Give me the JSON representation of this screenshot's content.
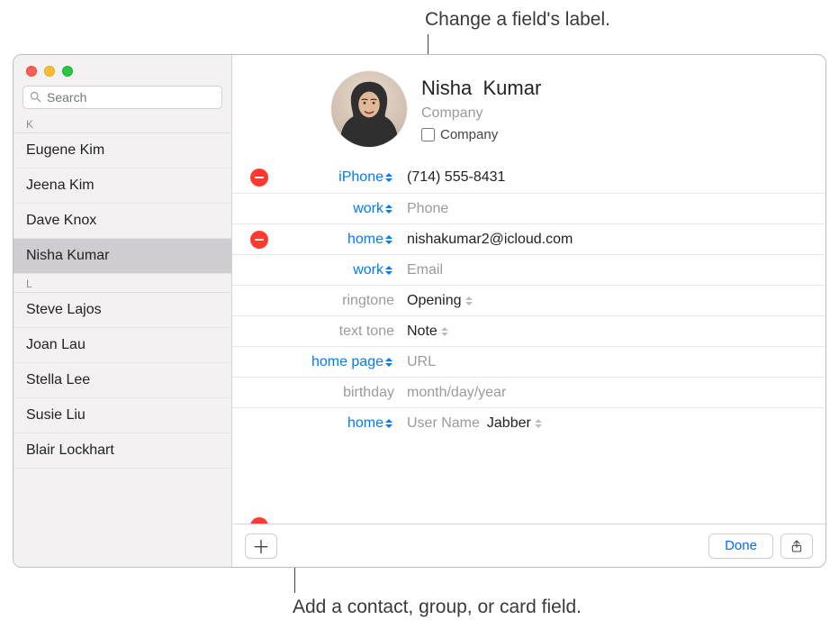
{
  "callouts": {
    "top": "Change a field's label.",
    "bottom": "Add a contact, group, or card field."
  },
  "sidebar": {
    "search_placeholder": "Search",
    "sections": [
      {
        "letter": "K",
        "items": [
          "Eugene Kim",
          "Jeena Kim",
          "Dave Knox",
          "Nisha Kumar"
        ],
        "selected": "Nisha Kumar"
      },
      {
        "letter": "L",
        "items": [
          "Steve Lajos",
          "Joan Lau",
          "Stella Lee",
          "Susie Liu",
          "Blair Lockhart"
        ]
      }
    ]
  },
  "contact": {
    "first_name": "Nisha",
    "last_name": "Kumar",
    "company_placeholder": "Company",
    "company_checkbox_label": "Company",
    "fields": {
      "phone_iphone": {
        "label": "iPhone",
        "value": "(714) 555-8431"
      },
      "phone_work": {
        "label": "work",
        "placeholder": "Phone"
      },
      "email_home": {
        "label": "home",
        "value": "nishakumar2@icloud.com"
      },
      "email_work": {
        "label": "work",
        "placeholder": "Email"
      },
      "ringtone": {
        "label": "ringtone",
        "value": "Opening"
      },
      "texttone": {
        "label": "text tone",
        "value": "Note"
      },
      "homepage": {
        "label": "home page",
        "placeholder": "URL"
      },
      "birthday": {
        "label": "birthday",
        "placeholder": "month/day/year"
      },
      "im_home": {
        "label": "home",
        "placeholder": "User Name",
        "service": "Jabber"
      }
    }
  },
  "toolbar": {
    "add_glyph": "＋",
    "done_label": "Done"
  }
}
